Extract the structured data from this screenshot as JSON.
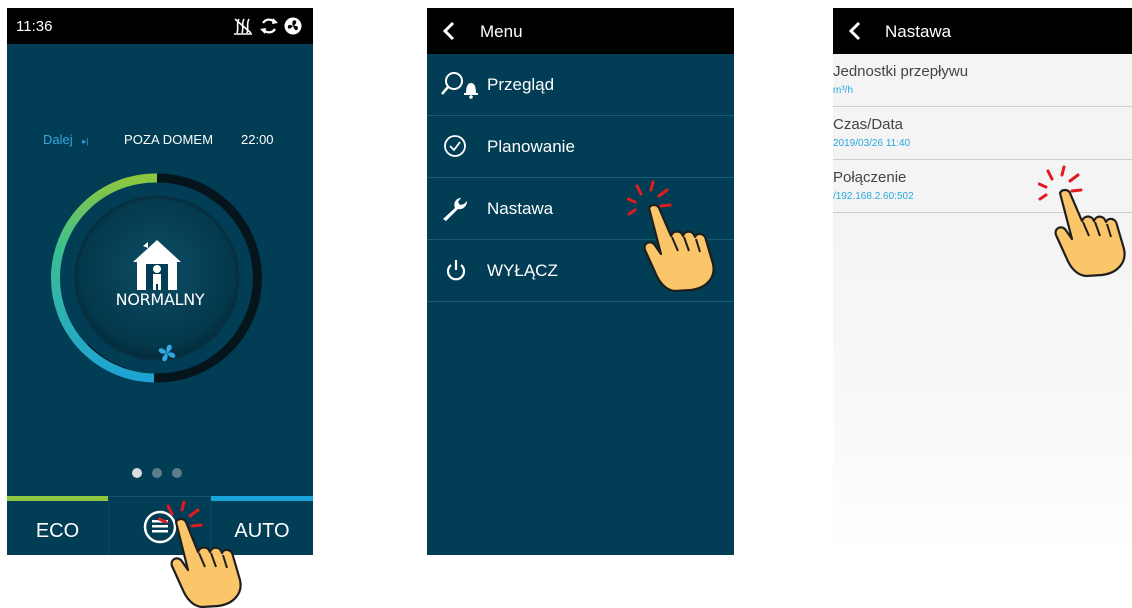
{
  "screen1": {
    "status_time": "11:36",
    "next_label": "Dalej",
    "next_arrow": "▸|",
    "current_mode": "POZA DOMEM",
    "mode_time": "22:00",
    "dial_mode": "NORMALNY",
    "bottom_tabs": {
      "eco": "ECO",
      "auto": "AUTO"
    },
    "page_dots": {
      "count": 3,
      "active": 1
    },
    "dial_level": 0.45,
    "colors": {
      "background": "#013d54",
      "eco": "#8dc63f",
      "auto": "#1aa3d9"
    },
    "icons": [
      "no-heat-icon",
      "sync-icon",
      "fan-status-icon",
      "house-person-icon",
      "fan-icon",
      "menu-icon"
    ]
  },
  "screen2": {
    "title": "Menu",
    "items": [
      {
        "label": "Przegląd",
        "icon": "overview-icon"
      },
      {
        "label": "Planowanie",
        "icon": "clock-icon"
      },
      {
        "label": "Nastawa",
        "icon": "wrench-icon"
      },
      {
        "label": "WYŁĄCZ",
        "icon": "power-icon"
      }
    ]
  },
  "screen3": {
    "title": "Nastawa",
    "rows": [
      {
        "name": "Jednostki przepływu",
        "value": "m³/h"
      },
      {
        "name": "Czas/Data",
        "value": "2019/03/26 11:40"
      },
      {
        "name": "Połączenie",
        "value": "/192.168.2.60:502"
      }
    ]
  }
}
